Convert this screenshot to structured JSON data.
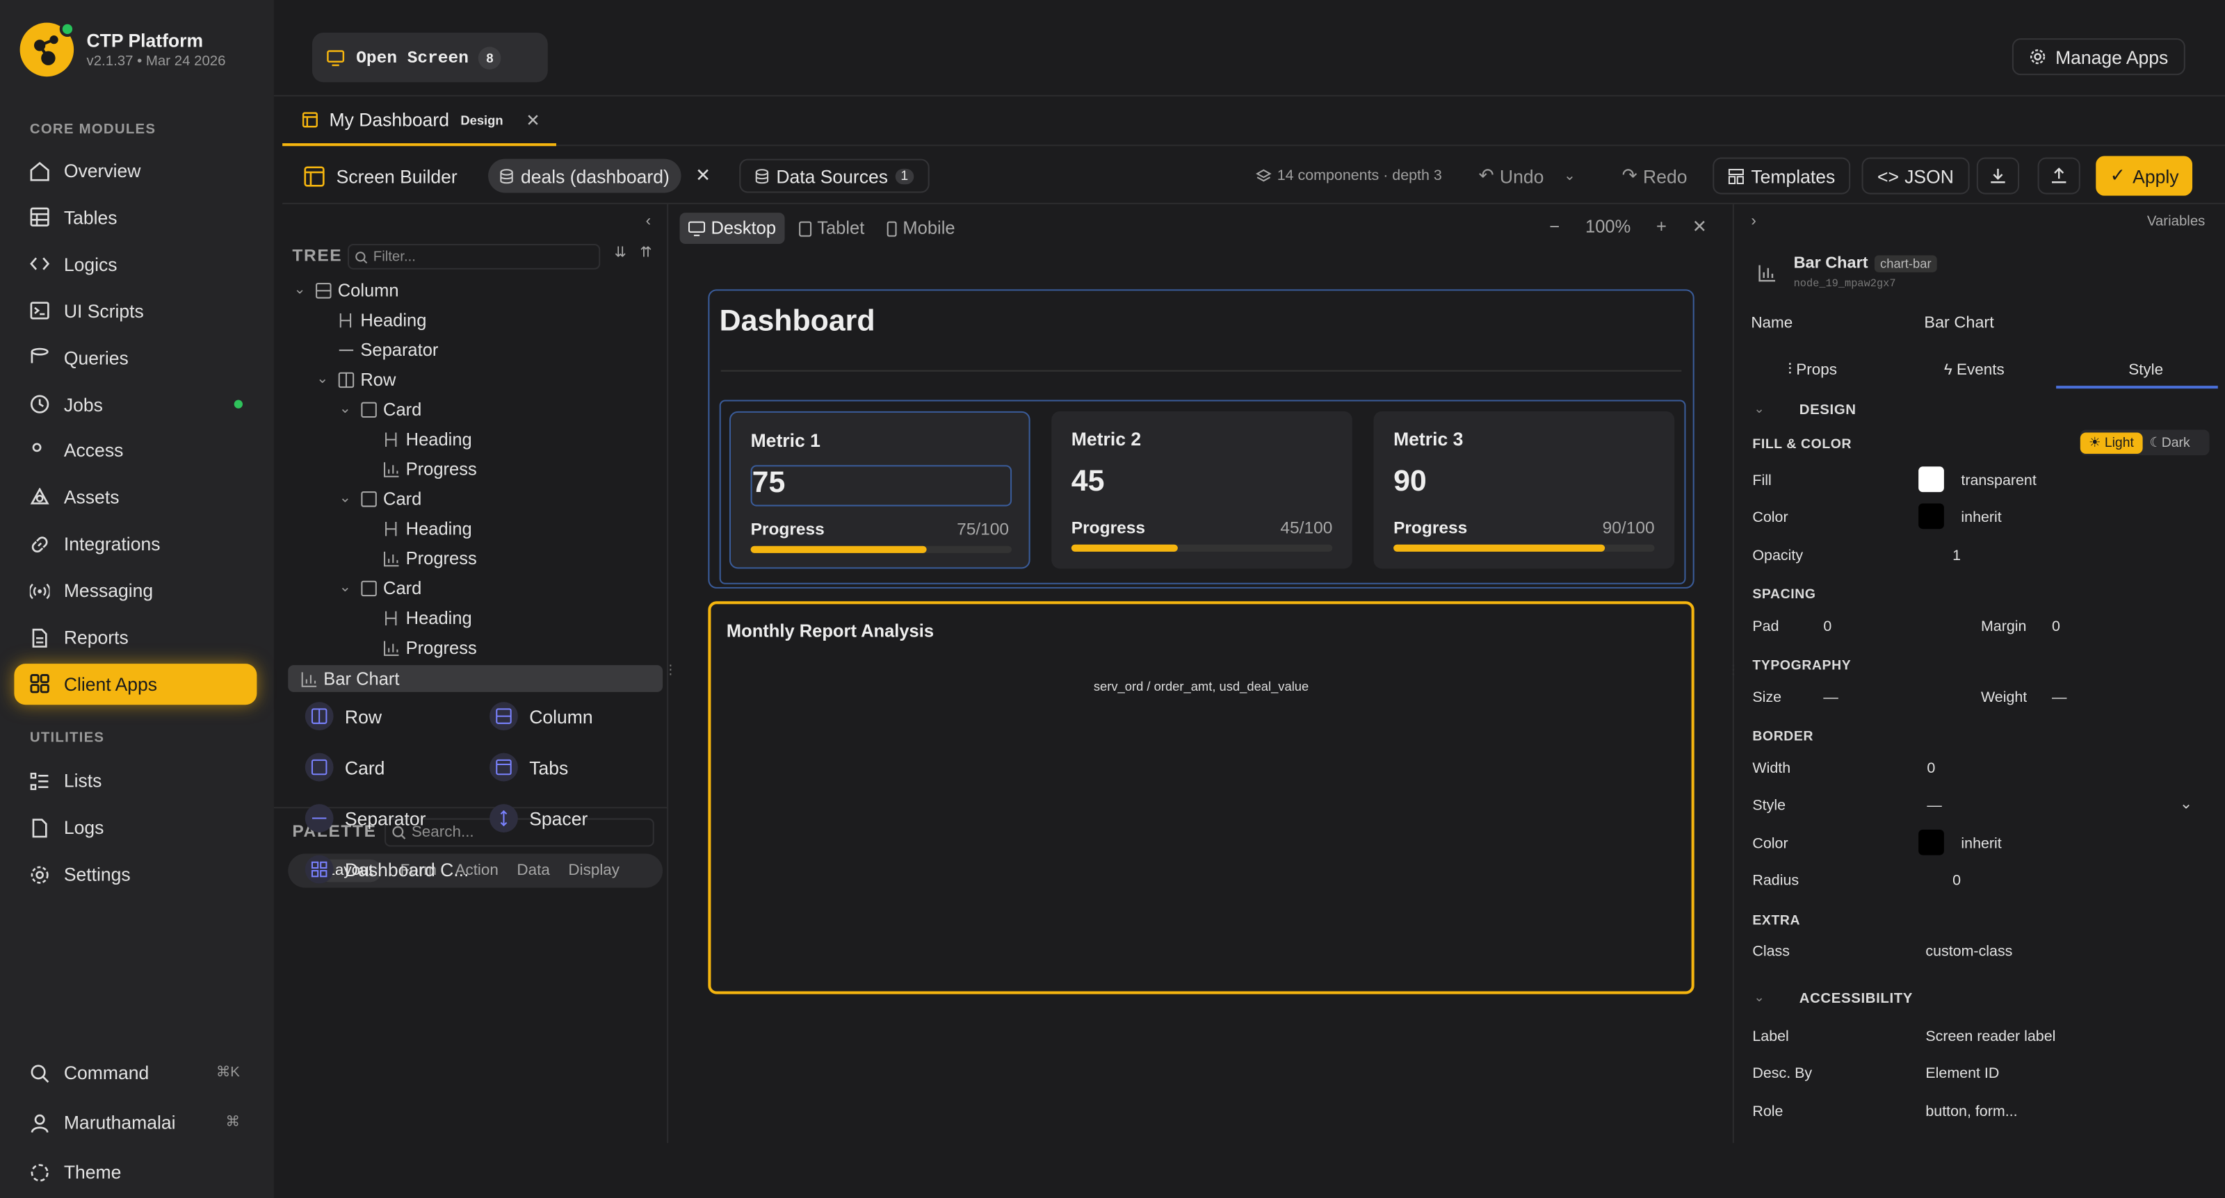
{
  "brand": {
    "name": "CTP Platform",
    "version": "v2.1.37 • Mar 24 2026"
  },
  "sidebar": {
    "core_label": "CORE MODULES",
    "core": [
      {
        "label": "Overview",
        "icon": "home-icon"
      },
      {
        "label": "Tables",
        "icon": "table-icon"
      },
      {
        "label": "Logics",
        "icon": "code-icon"
      },
      {
        "label": "UI Scripts",
        "icon": "terminal-icon"
      },
      {
        "label": "Queries",
        "icon": "database-icon"
      },
      {
        "label": "Jobs",
        "icon": "clock-icon"
      },
      {
        "label": "Access",
        "icon": "users-icon"
      },
      {
        "label": "Assets",
        "icon": "shapes-icon"
      },
      {
        "label": "Integrations",
        "icon": "link-icon"
      },
      {
        "label": "Messaging",
        "icon": "broadcast-icon"
      },
      {
        "label": "Reports",
        "icon": "file-icon"
      },
      {
        "label": "Client Apps",
        "icon": "grid-icon"
      }
    ],
    "util_label": "UTILITIES",
    "utilities": [
      {
        "label": "Lists",
        "icon": "list-icon"
      },
      {
        "label": "Logs",
        "icon": "file-text-icon"
      },
      {
        "label": "Settings",
        "icon": "gear-icon"
      }
    ],
    "bottom": {
      "command": "Command",
      "command_kbd": "⌘K",
      "user": "Maruthamalai",
      "user_kbd": "⌘",
      "theme": "Theme"
    }
  },
  "topbar": {
    "open_screen": "Open Screen",
    "open_count": "8",
    "manage_apps": "Manage Apps"
  },
  "doc_tab": {
    "label": "My Dashboard",
    "badge": "Design"
  },
  "toolbar": {
    "builder": "Screen Builder",
    "source": "deals (dashboard)",
    "data_sources": "Data Sources",
    "ds_count": "1",
    "components": "14 components · depth 3",
    "undo": "Undo",
    "redo": "Redo",
    "templates": "Templates",
    "json": "JSON",
    "apply": "Apply"
  },
  "tree": {
    "title": "TREE",
    "filter_placeholder": "Filter...",
    "nodes": {
      "column": "Column",
      "heading": "Heading",
      "separator": "Separator",
      "row": "Row",
      "card": "Card",
      "progress": "Progress",
      "bar_chart": "Bar Chart"
    }
  },
  "palette": {
    "title": "PALETTE",
    "search_placeholder": "Search...",
    "tabs": [
      "Layout",
      "Form",
      "Action",
      "Data",
      "Display"
    ],
    "items": [
      "Row",
      "Column",
      "Card",
      "Tabs",
      "Separator",
      "Spacer",
      "Dashboard C..."
    ]
  },
  "canvas": {
    "devices": [
      "Desktop",
      "Tablet",
      "Mobile"
    ],
    "zoom": "100%",
    "dash_title": "Dashboard",
    "metrics": [
      {
        "title": "Metric 1",
        "value": "75",
        "progress_label": "Progress",
        "progress_text": "75/100",
        "pct": 75
      },
      {
        "title": "Metric 2",
        "value": "45",
        "progress_label": "Progress",
        "progress_text": "45/100",
        "pct": 45
      },
      {
        "title": "Metric 3",
        "value": "90",
        "progress_label": "Progress",
        "progress_text": "90/100",
        "pct": 90
      }
    ],
    "chart_title": "Monthly Report Analysis",
    "chart_sub": "serv_ord / order_amt, usd_deal_value"
  },
  "props": {
    "variables": "Variables",
    "comp_name": "Bar Chart",
    "comp_type": "chart-bar",
    "node_id": "node_19_mpaw2gx7",
    "name_label": "Name",
    "name_value": "Bar Chart",
    "tabs": [
      "Props",
      "Events",
      "Style"
    ],
    "design": "DESIGN",
    "fill_color": "FILL & COLOR",
    "light": "Light",
    "dark": "Dark",
    "fill_label": "Fill",
    "fill_value": "transparent",
    "color_label": "Color",
    "color_value": "inherit",
    "opacity_label": "Opacity",
    "opacity_value": "1",
    "spacing": "SPACING",
    "pad_label": "Pad",
    "pad_value": "0",
    "margin_label": "Margin",
    "margin_value": "0",
    "typography": "TYPOGRAPHY",
    "size_label": "Size",
    "size_value": "—",
    "weight_label": "Weight",
    "weight_value": "—",
    "border": "BORDER",
    "width_label": "Width",
    "width_value": "0",
    "style_label": "Style",
    "style_value": "—",
    "bcolor_label": "Color",
    "bcolor_value": "inherit",
    "radius_label": "Radius",
    "radius_value": "0",
    "extra": "EXTRA",
    "class_label": "Class",
    "class_value": "custom-class",
    "accessibility": "ACCESSIBILITY",
    "label_label": "Label",
    "label_value": "Screen reader label",
    "desc_label": "Desc. By",
    "desc_value": "Element ID",
    "role_label": "Role",
    "role_value": "button, form..."
  }
}
